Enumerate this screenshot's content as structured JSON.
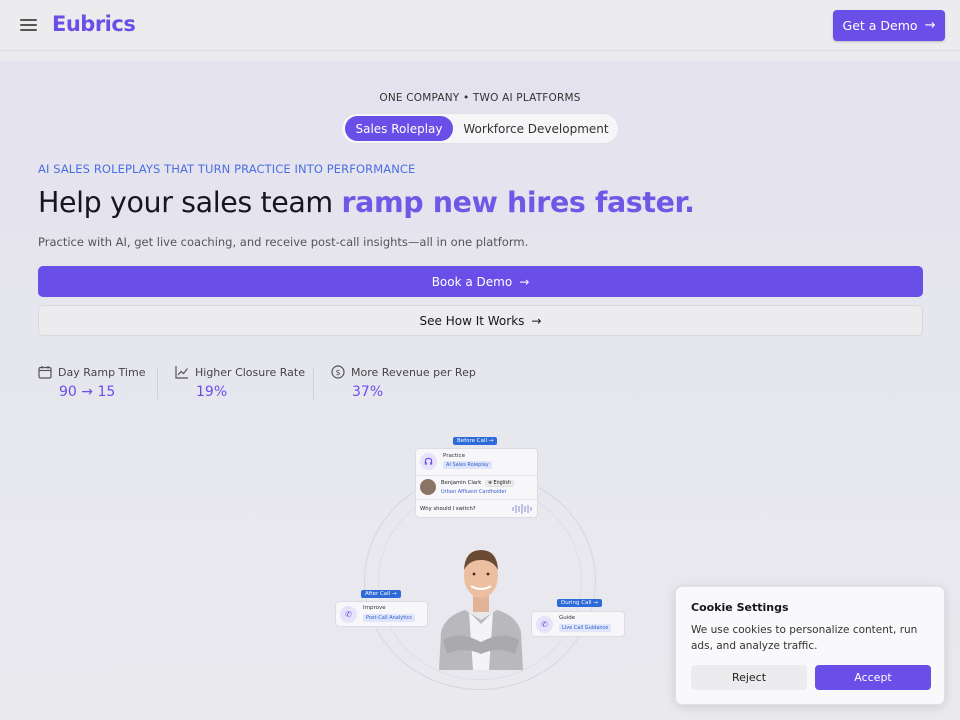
{
  "header": {
    "logo": "Eubrics",
    "cta_label": "Get a Demo",
    "menu_icon": "hamburger-menu-icon",
    "arrow_icon": "arrow-right-icon"
  },
  "hero": {
    "eyebrow": "ONE COMPANY • TWO AI PLATFORMS",
    "toggle": {
      "active": "Sales Roleplay",
      "inactive": "Workforce Development"
    },
    "kicker": "AI SALES ROLEPLAYS THAT TURN PRACTICE INTO PERFORMANCE",
    "headline_plain": "Help your sales team ",
    "headline_highlight": "ramp new hires faster.",
    "subhead": "Practice with AI, get live coaching, and receive post-call insights—all in one platform.",
    "primary_cta": "Book a Demo",
    "secondary_cta": "See How It Works"
  },
  "stats": [
    {
      "label": "Day Ramp Time",
      "value": "90 → 15",
      "icon": "calendar-icon"
    },
    {
      "label": "Higher Closure Rate",
      "value": "19%",
      "icon": "trend-chart-icon"
    },
    {
      "label": "More Revenue per Rep",
      "value": "37%",
      "icon": "dollar-circle-icon"
    }
  ],
  "illustration": {
    "before_call": {
      "tag": "Before Call",
      "title": "Practice",
      "pill": "AI Sales Roleplay",
      "persona_name": "Benjamin Clark",
      "language": "English",
      "persona_role": "Urban Affluent Cardholder",
      "question": "Why should I switch?"
    },
    "after_call": {
      "tag": "After Call",
      "title": "Improve",
      "pill": "Post-Call Analytics"
    },
    "during_call": {
      "tag": "During Call",
      "title": "Guide",
      "pill": "Live Call Guidance"
    }
  },
  "cookie": {
    "title": "Cookie Settings",
    "text": "We use cookies to personalize content, run ads, and analyze traffic.",
    "reject": "Reject",
    "accept": "Accept"
  },
  "colors": {
    "brand": "#6a4ee8",
    "kicker": "#4b6fe0",
    "tag_blue": "#2e6bd8"
  }
}
